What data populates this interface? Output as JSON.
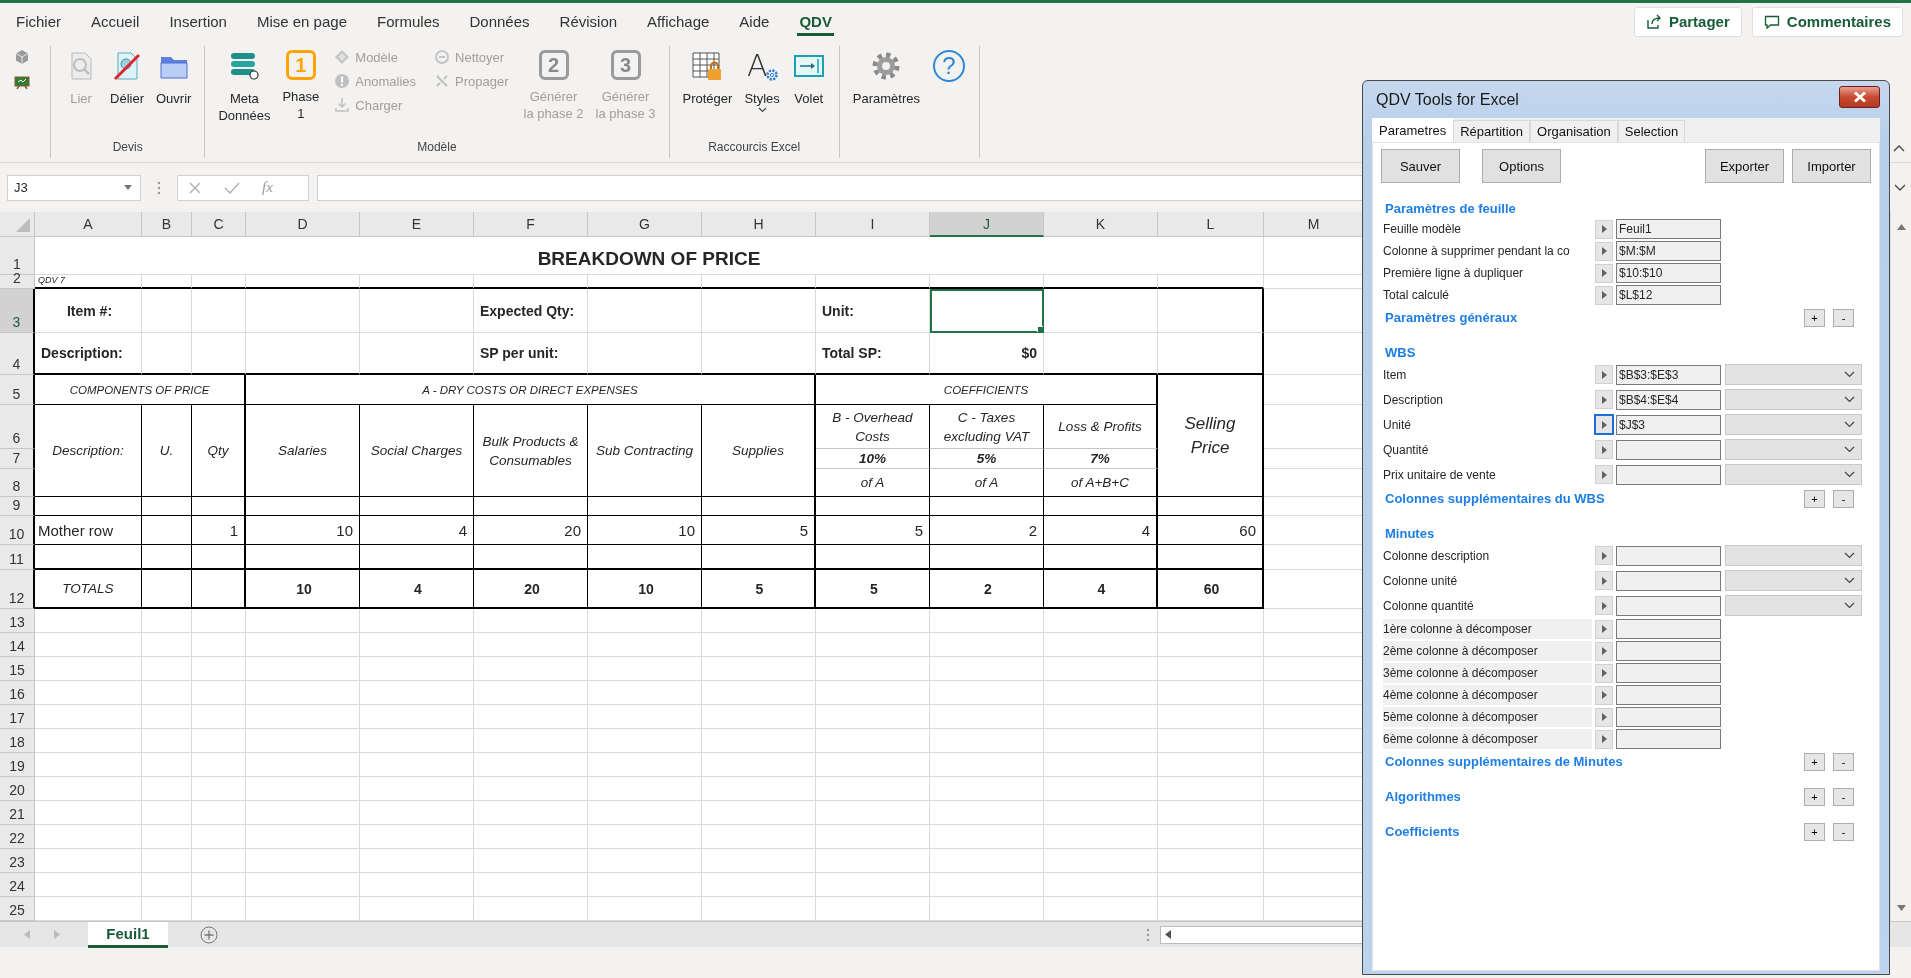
{
  "menu_tabs": [
    {
      "label": "Fichier",
      "selected": false
    },
    {
      "label": "Accueil",
      "selected": false
    },
    {
      "label": "Insertion",
      "selected": false
    },
    {
      "label": "Mise en page",
      "selected": false
    },
    {
      "label": "Formules",
      "selected": false
    },
    {
      "label": "Données",
      "selected": false
    },
    {
      "label": "Révision",
      "selected": false
    },
    {
      "label": "Affichage",
      "selected": false
    },
    {
      "label": "Aide",
      "selected": false
    },
    {
      "label": "QDV",
      "selected": true
    }
  ],
  "header_buttons": [
    "Partager",
    "Commentaires"
  ],
  "ribbon_groups": [
    {
      "label": "Devis",
      "items": [
        {
          "kind": "large",
          "label": "Lier",
          "disabled": true
        },
        {
          "kind": "large",
          "label": "Délier",
          "disabled": false
        },
        {
          "kind": "large",
          "label": "Ouvrir",
          "disabled": false
        }
      ]
    },
    {
      "label": "Modèle",
      "items": [
        {
          "kind": "large",
          "label": "Meta\nDonnées",
          "disabled": false
        },
        {
          "kind": "number",
          "badge": "1",
          "label": "Phase\n1",
          "disabled": false
        },
        {
          "kind": "stack",
          "items": [
            {
              "label": "Modèle",
              "disabled": true
            },
            {
              "label": "Anomalies",
              "disabled": true
            },
            {
              "label": "Charger",
              "disabled": true
            }
          ]
        },
        {
          "kind": "stack",
          "items": [
            {
              "label": "Nettoyer",
              "disabled": true
            },
            {
              "label": "Propager",
              "disabled": true
            }
          ]
        },
        {
          "kind": "number",
          "badge": "2",
          "label": "Générer\nla phase 2",
          "disabled": true
        },
        {
          "kind": "number",
          "badge": "3",
          "label": "Générer\nla phase 3",
          "disabled": true
        }
      ]
    },
    {
      "label": "Raccourcis Excel",
      "items": [
        {
          "kind": "large",
          "label": "Protéger",
          "disabled": false
        },
        {
          "kind": "letter",
          "badge": "A",
          "label": "Styles",
          "disabled": false,
          "menu": true
        },
        {
          "kind": "large",
          "label": "Volet",
          "disabled": false
        }
      ]
    },
    {
      "items": [
        {
          "kind": "large",
          "label": "Paramètres",
          "disabled": false
        },
        {
          "kind": "help",
          "badge": "?",
          "disabled": false
        }
      ]
    }
  ],
  "formula_bar": {
    "name_box": "J3",
    "function_button": "fx"
  },
  "sheet": {
    "columns": [
      {
        "label": "A",
        "selected": false
      },
      {
        "label": "B",
        "selected": false
      },
      {
        "label": "C",
        "selected": false
      },
      {
        "label": "D",
        "selected": false
      },
      {
        "label": "E",
        "selected": false
      },
      {
        "label": "F",
        "selected": false
      },
      {
        "label": "G",
        "selected": false
      },
      {
        "label": "H",
        "selected": false
      },
      {
        "label": "I",
        "selected": false
      },
      {
        "label": "J",
        "selected": true
      },
      {
        "label": "K",
        "selected": false
      },
      {
        "label": "L",
        "selected": false
      },
      {
        "label": "M",
        "selected": false
      }
    ],
    "rows": [
      {
        "label": "1",
        "selected": false
      },
      {
        "label": "2",
        "selected": false
      },
      {
        "label": "3",
        "selected": true
      },
      {
        "label": "4",
        "selected": false
      },
      {
        "label": "5",
        "selected": false
      },
      {
        "label": "6",
        "selected": false
      },
      {
        "label": "7",
        "selected": false
      },
      {
        "label": "8",
        "selected": false
      },
      {
        "label": "9",
        "selected": false
      },
      {
        "label": "10",
        "selected": false
      },
      {
        "label": "11",
        "selected": false
      },
      {
        "label": "12",
        "selected": false
      },
      {
        "label": "13",
        "selected": false
      },
      {
        "label": "14",
        "selected": false
      },
      {
        "label": "15",
        "selected": false
      },
      {
        "label": "16",
        "selected": false
      },
      {
        "label": "17",
        "selected": false
      },
      {
        "label": "18",
        "selected": false
      },
      {
        "label": "19",
        "selected": false
      },
      {
        "label": "20",
        "selected": false
      },
      {
        "label": "21",
        "selected": false
      },
      {
        "label": "22",
        "selected": false
      },
      {
        "label": "23",
        "selected": false
      },
      {
        "label": "24",
        "selected": false
      },
      {
        "label": "25",
        "selected": false
      }
    ],
    "cells": [
      "BREAKDOWN OF PRICE",
      "QDV 7",
      "Item #:",
      "Expected Qty:",
      "Unit:",
      "Description:",
      "SP per unit:",
      "Total SP:",
      "$0",
      "COMPONENTS OF PRICE",
      "A - DRY COSTS OR DIRECT EXPENSES",
      "COEFFICIENTS",
      "Selling Price",
      "Description:",
      "U.",
      "Qty",
      "Salaries",
      "Social Charges",
      "Bulk Products & Consumables",
      "Sub Contracting",
      "Supplies",
      "B - Overhead Costs",
      "C - Taxes excluding VAT",
      "Loss & Profits",
      "10%",
      "5%",
      "7%",
      "of A",
      "of A",
      "of A+B+C",
      "Mother row",
      "1",
      "10",
      "4",
      "20",
      "10",
      "5",
      "5",
      "2",
      "4",
      "60",
      "TOTALS",
      "10",
      "4",
      "20",
      "10",
      "5",
      "5",
      "2",
      "4",
      "60"
    ]
  },
  "sheet_tabs": [
    {
      "label": "Feuil1",
      "selected": true
    }
  ],
  "panel": {
    "title": "QDV Tools for Excel",
    "tabs": [
      {
        "label": "Parametres",
        "selected": true
      },
      {
        "label": "Répartition",
        "selected": false
      },
      {
        "label": "Organisation",
        "selected": false
      },
      {
        "label": "Selection",
        "selected": false
      }
    ],
    "buttons": [
      "Sauver",
      "Options",
      "Exporter",
      "Importer"
    ],
    "sections": [
      {
        "title": "Paramètres de feuille",
        "rows": [
          {
            "kind": "ref",
            "label": "Feuille modèle",
            "value": "Feuil1",
            "focused": false
          },
          {
            "kind": "ref",
            "label": "Colonne à supprimer pendant la co",
            "value": "$M:$M",
            "focused": false
          },
          {
            "kind": "ref",
            "label": "Première ligne à dupliquer",
            "value": "$10:$10",
            "focused": false
          },
          {
            "kind": "ref",
            "label": "Total calculé",
            "value": "$L$12",
            "focused": false
          }
        ]
      },
      {
        "title": "Paramètres généraux",
        "toggles": [
          "+",
          "-"
        ]
      },
      {
        "title": "WBS",
        "rows": [
          {
            "kind": "ref-dropdown",
            "label": "Item",
            "value": "$B$3:$E$3",
            "focused": false
          },
          {
            "kind": "ref-dropdown",
            "label": "Description",
            "value": "$B$4:$E$4",
            "focused": false
          },
          {
            "kind": "ref-dropdown",
            "label": "Unité",
            "value": "$J$3",
            "focused": true
          },
          {
            "kind": "ref-dropdown",
            "label": "Quantité",
            "focused": false
          },
          {
            "kind": "ref-dropdown",
            "label": "Prix unitaire de vente",
            "focused": false
          }
        ]
      },
      {
        "title": "Colonnes supplémentaires du WBS",
        "toggles": [
          "+",
          "-"
        ]
      },
      {
        "title": "Minutes",
        "rows": [
          {
            "kind": "ref-dropdown",
            "label": "Colonne description",
            "focused": false
          },
          {
            "kind": "ref-dropdown",
            "label": "Colonne unité",
            "focused": false
          },
          {
            "kind": "ref-dropdown",
            "label": "Colonne quantité",
            "focused": false
          },
          {
            "kind": "decompose",
            "label": "1ère colonne à décomposer",
            "focused": false
          },
          {
            "kind": "decompose",
            "label": "2ème colonne à décomposer",
            "focused": false
          },
          {
            "kind": "decompose",
            "label": "3ème colonne à décomposer",
            "focused": false
          },
          {
            "kind": "decompose",
            "label": "4ème colonne à décomposer",
            "focused": false
          },
          {
            "kind": "decompose",
            "label": "5ème colonne à décomposer",
            "focused": false
          },
          {
            "kind": "decompose",
            "label": "6ème colonne à décomposer",
            "focused": false
          }
        ]
      },
      {
        "title": "Colonnes supplémentaires de Minutes",
        "toggles": [
          "+",
          "-"
        ]
      },
      {
        "title": "Algorithmes",
        "toggles": [
          "+",
          "-"
        ]
      },
      {
        "title": "Coefficients",
        "toggles": [
          "+",
          "-"
        ]
      }
    ]
  }
}
